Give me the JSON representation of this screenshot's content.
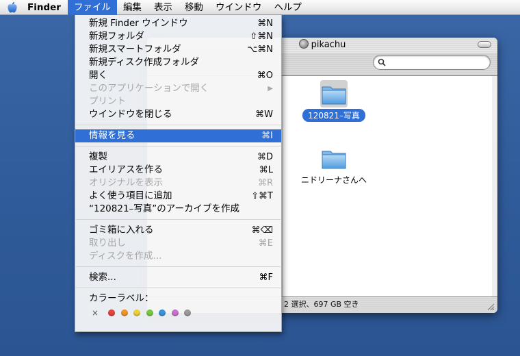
{
  "menubar": {
    "app_name": "Finder",
    "items": [
      "ファイル",
      "編集",
      "表示",
      "移動",
      "ウインドウ",
      "ヘルプ"
    ],
    "active_index": 0
  },
  "file_menu": {
    "items": [
      {
        "label": "新規 Finder ウインドウ",
        "shortcut": "⌘N",
        "enabled": true
      },
      {
        "label": "新規フォルダ",
        "shortcut": "⇧⌘N",
        "enabled": true
      },
      {
        "label": "新規スマートフォルダ",
        "shortcut": "⌥⌘N",
        "enabled": true
      },
      {
        "label": "新規ディスク作成フォルダ",
        "shortcut": "",
        "enabled": true
      },
      {
        "label": "開く",
        "shortcut": "⌘O",
        "enabled": true
      },
      {
        "label": "このアプリケーションで開く",
        "shortcut": "▶",
        "enabled": false
      },
      {
        "label": "プリント",
        "shortcut": "",
        "enabled": false
      },
      {
        "label": "ウインドウを閉じる",
        "shortcut": "⌘W",
        "enabled": true
      },
      {
        "label": "情報を見る",
        "shortcut": "⌘I",
        "enabled": true,
        "highlighted": true
      },
      {
        "label": "複製",
        "shortcut": "⌘D",
        "enabled": true
      },
      {
        "label": "エイリアスを作る",
        "shortcut": "⌘L",
        "enabled": true
      },
      {
        "label": "オリジナルを表示",
        "shortcut": "⌘R",
        "enabled": false
      },
      {
        "label": "よく使う項目に追加",
        "shortcut": "⇧⌘T",
        "enabled": true
      },
      {
        "label": "“120821–写真”のアーカイブを作成",
        "shortcut": "",
        "enabled": true
      },
      {
        "label": "ゴミ箱に入れる",
        "shortcut": "⌘⌫",
        "enabled": true
      },
      {
        "label": "取り出し",
        "shortcut": "⌘E",
        "enabled": false
      },
      {
        "label": "ディスクを作成...",
        "shortcut": "",
        "enabled": false
      },
      {
        "label": "検索...",
        "shortcut": "⌘F",
        "enabled": true
      },
      {
        "label": "カラーラベル：",
        "shortcut": "",
        "enabled": true
      }
    ],
    "label_none_glyph": "×",
    "label_colors": [
      "#e8423c",
      "#f2962b",
      "#efd23a",
      "#7ac943",
      "#3a94e0",
      "#c872d0",
      "#9c9c9c"
    ]
  },
  "window": {
    "title": "pikachu",
    "status": "2 選択、697 GB 空き",
    "items": [
      {
        "name": "120821–写真",
        "selected": true
      },
      {
        "name": "ニドリーナさんへ",
        "selected": false
      }
    ]
  },
  "colors": {
    "highlight": "#2f6fd6",
    "desktop": "#2f5c9c"
  }
}
